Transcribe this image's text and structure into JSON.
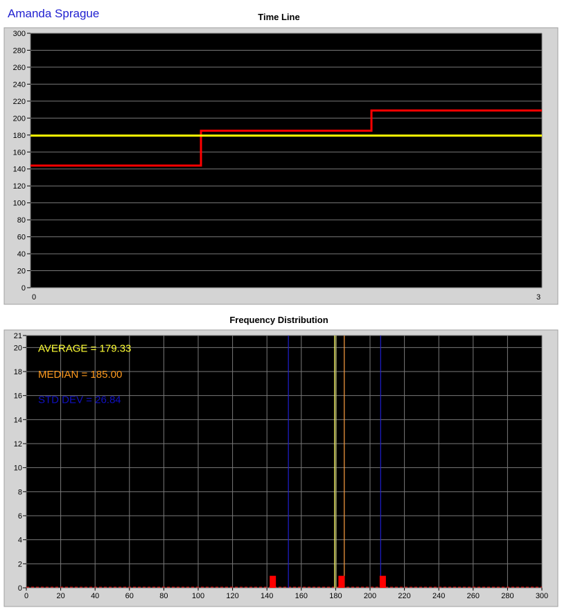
{
  "header": {
    "student_name": "Amanda Sprague"
  },
  "chart_data": [
    {
      "type": "line",
      "title": "Time Line",
      "xlim": [
        0,
        3
      ],
      "ylim": [
        0,
        300
      ],
      "x_ticks": [
        0,
        3
      ],
      "y_ticks": [
        0,
        20,
        40,
        60,
        80,
        100,
        120,
        140,
        160,
        180,
        200,
        220,
        240,
        260,
        280,
        300
      ],
      "grid": true,
      "background": "#000000",
      "series": [
        {
          "style": "step",
          "color": "#ff0000",
          "x": [
            0,
            1,
            2,
            3
          ],
          "y": [
            144,
            185,
            209,
            209
          ]
        },
        {
          "style": "line",
          "color": "#ffff00",
          "x": [
            0,
            3
          ],
          "y": [
            179.33,
            179.33
          ]
        }
      ]
    },
    {
      "type": "bar",
      "title": "Frequency Distribution",
      "xlim": [
        0,
        300
      ],
      "ylim": [
        0,
        21
      ],
      "x_ticks": [
        0,
        20,
        40,
        60,
        80,
        100,
        120,
        140,
        160,
        180,
        200,
        220,
        240,
        260,
        280,
        300
      ],
      "y_ticks": [
        0,
        2,
        4,
        6,
        8,
        10,
        12,
        14,
        16,
        18,
        20,
        21
      ],
      "grid": true,
      "background": "#000000",
      "bars": [
        {
          "x": 142,
          "value": 1
        },
        {
          "x": 182,
          "value": 1
        },
        {
          "x": 206,
          "value": 1
        }
      ],
      "bar_color": "#ff0000",
      "baseline_color": "#ff0000",
      "vertical_lines": [
        {
          "x": 152.49,
          "color": "#1f1fd0"
        },
        {
          "x": 179.33,
          "color": "#ffff66"
        },
        {
          "x": 180.2,
          "color": "#c8c870"
        },
        {
          "x": 185.0,
          "color": "#ffa040"
        },
        {
          "x": 206.17,
          "color": "#1f1fd0"
        }
      ],
      "annotations": [
        {
          "text": "AVERAGE = 179.33",
          "color": "#ffff33"
        },
        {
          "text": "MEDIAN = 185.00",
          "color": "#ff9a1e"
        },
        {
          "text": "STD DEV = 26.84",
          "color": "#1010c0"
        }
      ]
    }
  ]
}
